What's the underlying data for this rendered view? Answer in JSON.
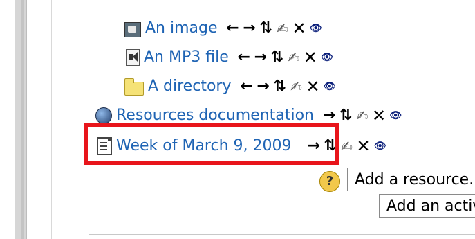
{
  "resources": [
    {
      "name": "image",
      "label": "An image",
      "icon": "image-icon",
      "actions": [
        "move-left",
        "move-right",
        "move-updown",
        "edit",
        "delete",
        "hide"
      ]
    },
    {
      "name": "mp3",
      "label": "An MP3 file",
      "icon": "audio-file-icon",
      "actions": [
        "move-left",
        "move-right",
        "move-updown",
        "edit",
        "delete",
        "hide"
      ]
    },
    {
      "name": "directory",
      "label": "A directory",
      "icon": "folder-icon",
      "actions": [
        "move-left",
        "move-right",
        "move-updown",
        "edit",
        "delete",
        "hide"
      ]
    },
    {
      "name": "resources-doc",
      "label": "Resources documentation",
      "icon": "globe-icon",
      "actions": [
        "move-right",
        "move-updown",
        "edit",
        "delete",
        "hide"
      ]
    },
    {
      "name": "week-page",
      "label": "Week of March 9, 2009",
      "icon": "text-page-icon",
      "actions": [
        "move-right",
        "move-updown",
        "edit",
        "delete",
        "hide"
      ]
    }
  ],
  "action_glyphs": {
    "move-left": "←",
    "move-right": "→",
    "move-updown": "⇅",
    "edit": "✍",
    "delete": "✕",
    "hide": "👁"
  },
  "add_resource": {
    "label": "Add a resource..."
  },
  "add_activity": {
    "label": "Add an activity..."
  },
  "help": {
    "glyph": "?"
  },
  "colors": {
    "link": "#1f64b4",
    "highlight": "#e8151b"
  }
}
